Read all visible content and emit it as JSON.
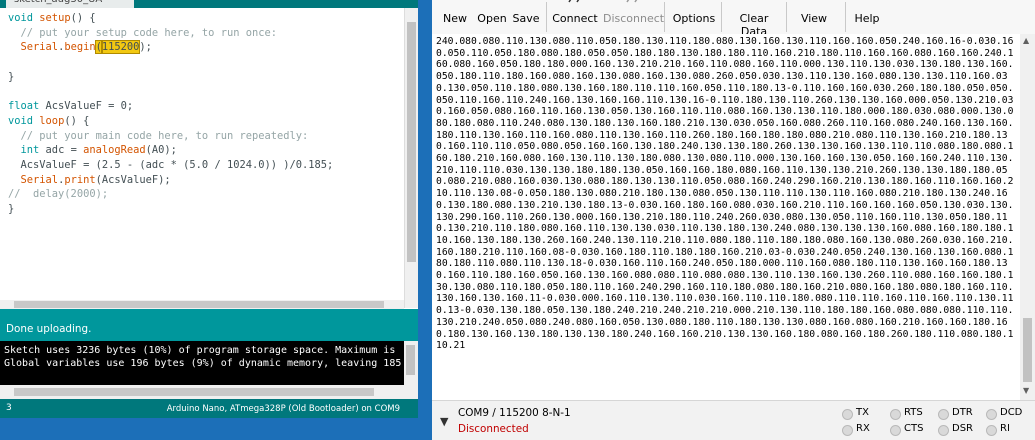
{
  "ide": {
    "tab_title": "sketch_aug30_UA",
    "code": [
      {
        "segments": [
          {
            "t": "void",
            "c": "kw-type"
          },
          {
            "t": " "
          },
          {
            "t": "setup",
            "c": "kw-fn"
          },
          {
            "t": "() {"
          }
        ]
      },
      {
        "segments": [
          {
            "t": "  // put your setup code here, to run once:",
            "c": "cmt"
          }
        ]
      },
      {
        "segments": [
          {
            "t": "  "
          },
          {
            "t": "Serial",
            "c": "kw-fn"
          },
          {
            "t": "."
          },
          {
            "t": "begin",
            "c": "kw-fn"
          },
          {
            "t": "(",
            "c": "hl"
          },
          {
            "t": "115200",
            "c": "hl"
          },
          {
            "t": ");"
          }
        ]
      },
      {
        "segments": [
          {
            "t": ""
          }
        ]
      },
      {
        "segments": [
          {
            "t": "}"
          }
        ]
      },
      {
        "segments": [
          {
            "t": ""
          }
        ]
      },
      {
        "segments": [
          {
            "t": "float",
            "c": "kw-type"
          },
          {
            "t": " AcsValueF = 0;"
          }
        ]
      },
      {
        "segments": [
          {
            "t": "void",
            "c": "kw-type"
          },
          {
            "t": " "
          },
          {
            "t": "loop",
            "c": "kw-fn"
          },
          {
            "t": "() {"
          }
        ]
      },
      {
        "segments": [
          {
            "t": "  // put your main code here, to run repeatedly:",
            "c": "cmt"
          }
        ]
      },
      {
        "segments": [
          {
            "t": "  "
          },
          {
            "t": "int",
            "c": "kw-type"
          },
          {
            "t": " adc = "
          },
          {
            "t": "analogRead",
            "c": "kw-fn"
          },
          {
            "t": "(A0);"
          }
        ]
      },
      {
        "segments": [
          {
            "t": "  AcsValueF = (2.5 - (adc * (5.0 / 1024.0)) )/0.185;"
          }
        ]
      },
      {
        "segments": [
          {
            "t": "  "
          },
          {
            "t": "Serial",
            "c": "kw-fn"
          },
          {
            "t": "."
          },
          {
            "t": "print",
            "c": "kw-fn"
          },
          {
            "t": "(AcsValueF);"
          }
        ]
      },
      {
        "segments": [
          {
            "t": "//  delay(2000);",
            "c": "cmt"
          }
        ]
      },
      {
        "segments": [
          {
            "t": "}"
          }
        ]
      }
    ],
    "status_message": "Done uploading.",
    "console_lines": [
      "Sketch uses 3236 bytes (10%) of program storage space. Maximum is",
      "Global variables use 196 bytes (9%) of dynamic memory, leaving 185"
    ],
    "line_number": "3",
    "board_info": "Arduino Nano, ATmega328P (Old Bootloader) on COM9"
  },
  "serial": {
    "toolbar": [
      {
        "id": "new",
        "label": "New",
        "icon": "new-icon",
        "enabled": true
      },
      {
        "id": "open",
        "label": "Open",
        "icon": "open-icon",
        "enabled": true
      },
      {
        "id": "save",
        "label": "Save",
        "icon": "save-icon",
        "enabled": true
      },
      {
        "id": "connect",
        "label": "Connect",
        "icon": "connect-icon",
        "enabled": true
      },
      {
        "id": "disconnect",
        "label": "Disconnect",
        "icon": "disconnect-icon",
        "enabled": false
      },
      {
        "id": "options",
        "label": "Options",
        "icon": "gear-icon",
        "enabled": true
      },
      {
        "id": "clear",
        "label": "Clear Data",
        "icon": "clear-icon",
        "enabled": true
      },
      {
        "id": "view",
        "label": "View",
        "icon": "view-icon",
        "enabled": true
      },
      {
        "id": "help",
        "label": "Help",
        "icon": "help-icon",
        "enabled": true
      }
    ],
    "output_text": "240.080.080.110.130.080.110.050.180.130.110.180.080.130.160.130.110.160.160.050.240.160.16-0.030.160.050.110.050.180.080.180.050.050.180.180.130.180.180.110.160.210.180.110.160.160.080.160.160.240.160.080.160.050.180.180.000.160.130.210.210.160.110.080.160.110.000.130.110.130.030.130.180.130.160.050.180.110.180.160.080.160.130.080.160.130.080.260.050.030.130.110.130.160.080.130.130.110.160.030.130.050.110.180.080.130.160.180.110.110.160.050.110.180.13-0.110.160.160.030.260.180.180.050.050.050.110.160.110.240.160.130.160.160.110.130.16-0.110.180.130.110.260.130.130.160.000.050.130.210.030.160.050.080.160.110.160.130.050.130.160.110.110.080.160.130.130.110.180.000.180.030.080.000.130.080.180.080.110.240.080.130.180.130.160.180.210.130.030.050.160.080.260.110.160.080.240.160.130.160.180.110.130.160.110.160.080.110.130.160.110.260.180.160.180.180.080.210.080.110.130.160.210.180.130.160.110.110.050.080.050.160.160.130.180.240.130.130.180.260.130.130.160.130.110.110.080.180.080.160.180.210.160.080.160.130.110.130.180.080.130.080.110.000.130.160.160.130.050.160.160.240.110.130.210.110.110.030.130.130.180.180.130.050.160.160.180.080.160.110.130.130.210.260.130.130.180.180.050.080.210.080.160.030.130.080.180.130.130.110.050.080.160.240.290.160.210.130.180.160.110.160.160.210.110.130.08-0.050.180.130.080.210.180.130.080.050.130.110.110.130.110.160.080.210.180.130.240.160.130.180.080.130.210.130.180.13-0.030.160.180.160.080.030.160.210.110.160.160.160.050.130.030.130.130.290.160.110.260.130.000.160.130.210.180.110.240.260.030.080.130.050.110.160.110.130.050.180.110.130.210.110.180.080.160.110.130.130.030.110.130.180.130.240.080.130.130.130.160.080.160.180.180.110.160.130.180.130.260.160.240.130.110.210.110.080.180.110.180.180.080.160.130.080.260.030.160.210.160.180.210.110.160.08-0.030.160.180.110.180.180.160.210.03-0.030.240.050.240.130.160.130.160.080.180.180.110.080.110.130.18-0.030.160.110.160.240.050.180.000.110.160.080.180.110.130.160.160.180.130.160.110.180.160.050.160.130.160.080.080.110.080.080.130.110.130.160.130.260.110.080.160.160.180.130.130.080.110.180.050.180.110.160.240.290.160.110.180.080.180.160.210.080.160.180.080.180.160.110.130.160.130.160.11-0.030.000.160.110.130.110.030.160.110.110.180.080.110.110.160.110.160.110.130.110.13-0.030.130.180.050.130.180.240.210.240.210.210.000.210.130.110.180.180.160.080.080.080.110.110.130.210.240.050.080.240.080.160.050.130.080.180.110.180.130.130.080.160.080.160.210.160.160.180.160.180.130.160.130.180.130.130.180.240.160.160.210.130.130.160.180.080.160.180.260.180.110.080.180.110.21",
    "port_settings": "COM9 / 115200 8-N-1",
    "connection_state": "Disconnected",
    "leds": [
      {
        "label": "TX"
      },
      {
        "label": "RTS"
      },
      {
        "label": "DTR"
      },
      {
        "label": "DCD"
      },
      {
        "label": "RX"
      },
      {
        "label": "CTS"
      },
      {
        "label": "DSR"
      },
      {
        "label": "RI"
      }
    ]
  }
}
